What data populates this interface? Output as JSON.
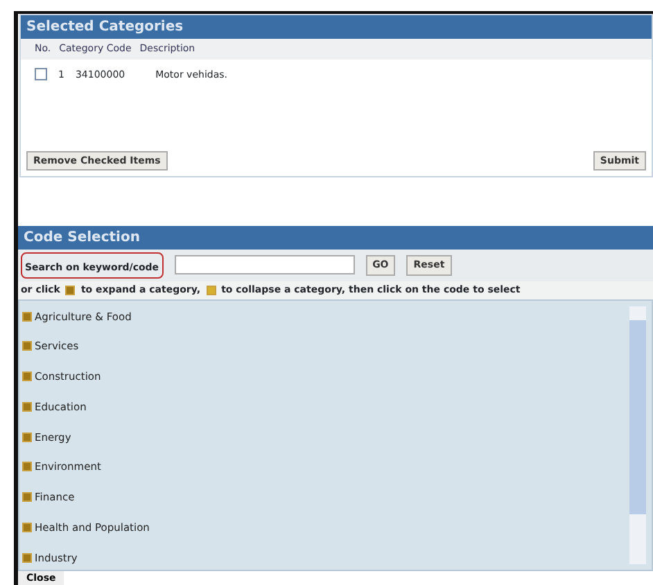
{
  "selected_categories": {
    "title": "Selected Categories",
    "columns": [
      "No.",
      "Category Code",
      "Description"
    ],
    "rows": [
      {
        "checked": false,
        "no": "1",
        "code": "34100000",
        "description": "Motor vehidas."
      }
    ],
    "buttons": [
      "Remove Checked Items",
      "Submit"
    ]
  },
  "code_selection": {
    "title": "Code Selection",
    "search_label": "Search on keyword/code",
    "buttons": [
      "GO",
      "Reset"
    ],
    "hint": [
      {
        "kind": "text",
        "text": "or click"
      },
      {
        "kind": "icon",
        "expanded": false
      },
      {
        "kind": "text",
        "text": "to expand a category,"
      },
      {
        "kind": "icon",
        "expanded": true
      },
      {
        "kind": "text",
        "text": "to collapse a category, then click on the code to select"
      }
    ],
    "categories": [
      {
        "label": "Agriculture & Food",
        "expanded": false
      },
      {
        "label": "Services",
        "expanded": false
      },
      {
        "label": "Construction",
        "expanded": false
      },
      {
        "label": "Education",
        "expanded": false
      },
      {
        "label": "Energy",
        "expanded": false
      },
      {
        "label": "Environment",
        "expanded": false
      },
      {
        "label": "Finance",
        "expanded": false
      },
      {
        "label": "Health and Population",
        "expanded": false
      },
      {
        "label": "Industry",
        "expanded": false
      }
    ],
    "close": "Close"
  }
}
